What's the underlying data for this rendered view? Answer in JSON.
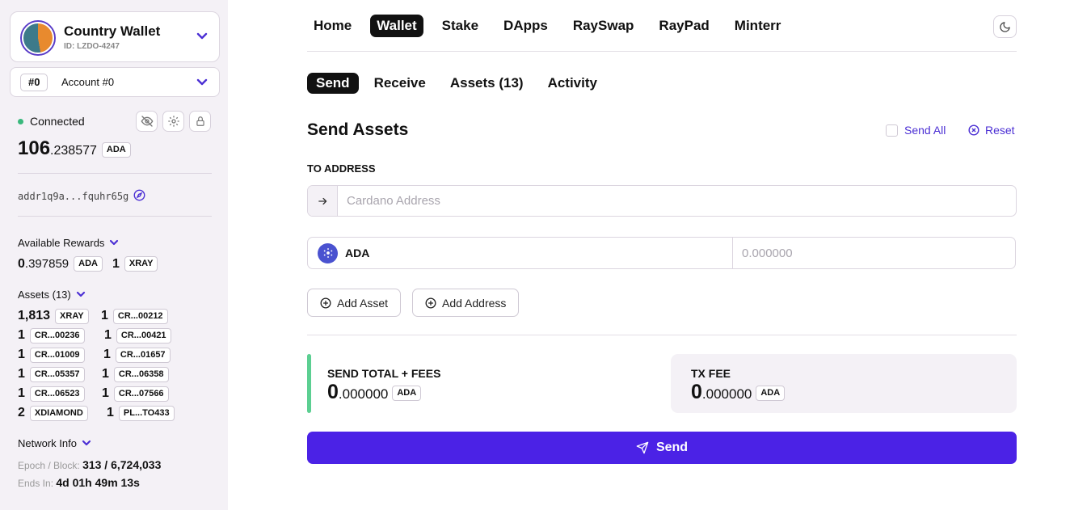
{
  "sidebar": {
    "wallet_name": "Country Wallet",
    "wallet_id": "ID: LZDO-4247",
    "account_badge": "#0",
    "account_name": "Account #0",
    "status": "Connected",
    "balance_int": "106",
    "balance_dec": ".238577",
    "balance_unit": "ADA",
    "address": "addr1q9a...fquhr65g",
    "rewards_label": "Available Rewards",
    "rewards_int": "0",
    "rewards_dec": ".397859",
    "rewards_unit": "ADA",
    "rewards_xray_qty": "1",
    "rewards_xray_unit": "XRAY",
    "assets_label": "Assets (13)",
    "assets": [
      {
        "qty": "1,813",
        "name": "XRAY"
      },
      {
        "qty": "1",
        "name": "CR...00212"
      },
      {
        "qty": "1",
        "name": "CR...00236"
      },
      {
        "qty": "1",
        "name": "CR...00421"
      },
      {
        "qty": "1",
        "name": "CR...01009"
      },
      {
        "qty": "1",
        "name": "CR...01657"
      },
      {
        "qty": "1",
        "name": "CR...05357"
      },
      {
        "qty": "1",
        "name": "CR...06358"
      },
      {
        "qty": "1",
        "name": "CR...06523"
      },
      {
        "qty": "1",
        "name": "CR...07566"
      },
      {
        "qty": "2",
        "name": "XDIAMOND"
      },
      {
        "qty": "1",
        "name": "PL...TO433"
      }
    ],
    "network_label": "Network Info",
    "epoch_label": "Epoch / Block:",
    "epoch_value": "313 / 6,724,033",
    "ends_label": "Ends In:",
    "ends_value": "4d 01h 49m 13s"
  },
  "nav": {
    "items": [
      "Home",
      "Wallet",
      "Stake",
      "DApps",
      "RaySwap",
      "RayPad",
      "Minterr"
    ],
    "active": "Wallet"
  },
  "tabs": {
    "items": [
      "Send",
      "Receive",
      "Assets (13)",
      "Activity"
    ],
    "active": "Send"
  },
  "send": {
    "title": "Send Assets",
    "send_all_label": "Send All",
    "reset_label": "Reset",
    "to_address_label": "TO ADDRESS",
    "address_placeholder": "Cardano Address",
    "asset_name": "ADA",
    "amount_placeholder": "0.000000",
    "add_asset_label": "Add Asset",
    "add_address_label": "Add Address",
    "total_label": "SEND TOTAL + FEES",
    "total_int": "0",
    "total_dec": ".000000",
    "total_unit": "ADA",
    "fee_label": "TX FEE",
    "fee_int": "0",
    "fee_dec": ".000000",
    "fee_unit": "ADA",
    "send_button_label": "Send"
  },
  "colors": {
    "accent": "#4b22e6",
    "link": "#4b2fd4",
    "connected": "#39b87c",
    "total_bar": "#5ccf92"
  }
}
